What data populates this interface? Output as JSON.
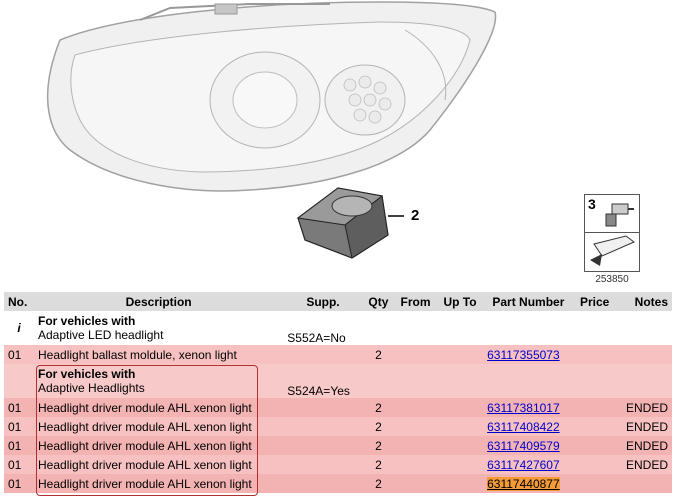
{
  "diagram": {
    "callout_label": "2",
    "ref_badge_number": "3",
    "ref_code": "253850"
  },
  "table": {
    "headers": [
      "No.",
      "Description",
      "Supp.",
      "Qty",
      "From",
      "Up To",
      "Part Number",
      "Price",
      "Notes"
    ],
    "info_row": {
      "no": "i",
      "title": "For vehicles with",
      "subtitle": "Adaptive LED headlight",
      "supp": "S552A=No"
    },
    "row1": {
      "no": "01",
      "desc": "Headlight ballast moldule, xenon light",
      "qty": "2",
      "part": "63117355073",
      "notes": ""
    },
    "group_row": {
      "title": "For vehicles with",
      "subtitle": "Adaptive Headlights",
      "supp": "S524A=Yes"
    },
    "rows": [
      {
        "no": "01",
        "desc": "Headlight driver module AHL xenon light",
        "qty": "2",
        "part": "63117381017",
        "notes": "ENDED"
      },
      {
        "no": "01",
        "desc": "Headlight driver module AHL xenon light",
        "qty": "2",
        "part": "63117408422",
        "notes": "ENDED"
      },
      {
        "no": "01",
        "desc": "Headlight driver module AHL xenon light",
        "qty": "2",
        "part": "63117409579",
        "notes": "ENDED"
      },
      {
        "no": "01",
        "desc": "Headlight driver module AHL xenon light",
        "qty": "2",
        "part": "63117427607",
        "notes": "ENDED"
      },
      {
        "no": "01",
        "desc": "Headlight driver module AHL xenon light",
        "qty": "2",
        "part": "63117440877",
        "notes": ""
      }
    ]
  }
}
